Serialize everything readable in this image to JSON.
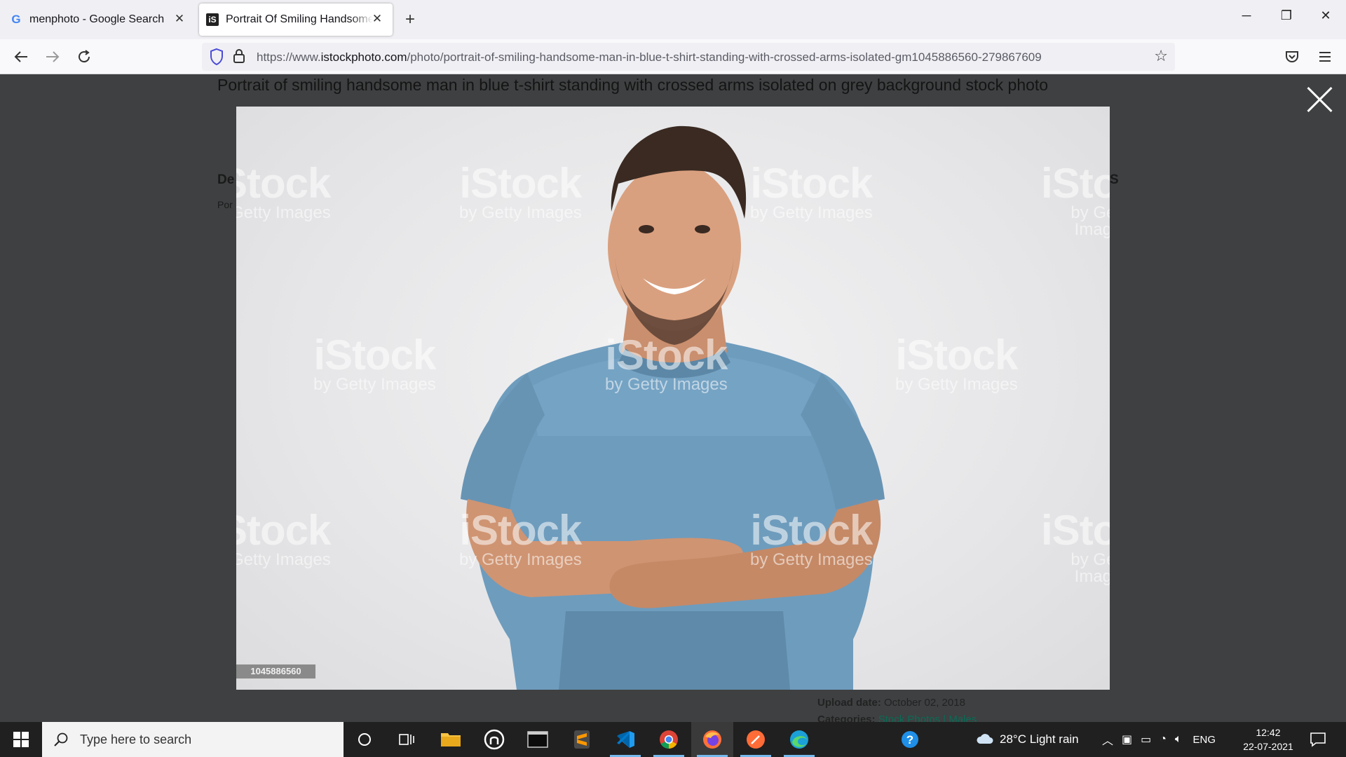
{
  "browser": {
    "tabs": [
      {
        "title": "menphoto - Google Search",
        "favicon": "G",
        "active": false
      },
      {
        "title": "Portrait Of Smiling Handsome Man",
        "favicon": "iS",
        "active": true
      }
    ],
    "url_prefix": "https://www.",
    "url_domain": "istockphoto.com",
    "url_path": "/photo/portrait-of-smiling-handsome-man-in-blue-t-shirt-standing-with-crossed-arms-isolated-gm1045886560-279867609"
  },
  "page": {
    "title": "Portrait of smiling handsome man in blue t-shirt standing with crossed arms isolated on grey background stock photo",
    "ghost_heading": "De",
    "ghost_sub": "Por",
    "ghost_right": "S",
    "photo_id": "1045886560",
    "watermark_brand": "iStock",
    "watermark_by": "by Getty Images",
    "upload_label": "Upload date:",
    "upload_value": "October 02, 2018",
    "categories_label": "Categories:",
    "categories_value": "Stock Photos | Males"
  },
  "taskbar": {
    "search_placeholder": "Type here to search",
    "weather": "28°C  Light rain",
    "language": "ENG",
    "time": "12:42",
    "date": "22-07-2021"
  }
}
